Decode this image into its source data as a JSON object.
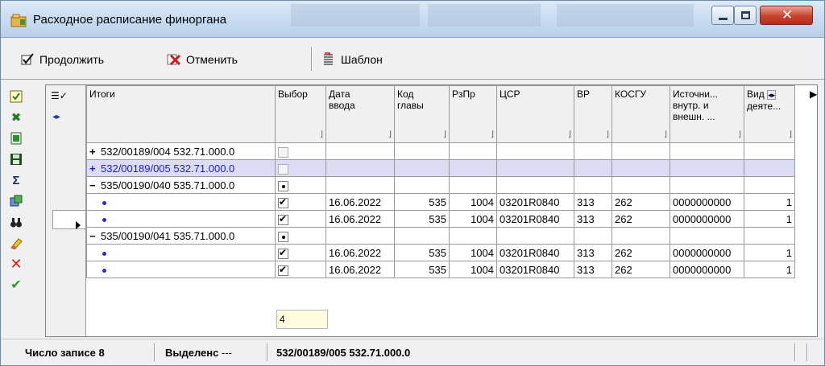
{
  "window": {
    "title": "Расходное расписание финоргана"
  },
  "toolbar": {
    "continue_label": "Продолжить",
    "cancel_label": "Отменить",
    "template_label": "Шаблон"
  },
  "grid": {
    "columns": {
      "itogi": "Итоги",
      "vybor": "Выбор",
      "data_vvoda_1": "Дата",
      "data_vvoda_2": "ввода",
      "kod_glavy_1": "Код",
      "kod_glavy_2": "главы",
      "rzpr": "РзПр",
      "csr": "ЦСР",
      "vr": "ВР",
      "kosgu": "КОСГУ",
      "istochnik_1": "Источни...",
      "istochnik_2": "внутр. и",
      "istochnik_3": "внешн. ...",
      "vid_1": "Вид",
      "vid_2": "деяте..."
    },
    "groups": [
      {
        "sign": "+",
        "label": "532/00189/004 532.71.000.0"
      },
      {
        "sign": "+",
        "label": "532/00189/005 532.71.000.0"
      },
      {
        "sign": "−",
        "label": "535/00190/040 535.71.000.0"
      },
      {
        "sign": "−",
        "label": "535/00190/041 535.71.000.0"
      }
    ],
    "rows": [
      {
        "date": "16.06.2022",
        "kod": "535",
        "rzpr": "1004",
        "csr": "03201R0840",
        "vr": "313",
        "kosgu": "262",
        "ist": "0000000000",
        "vid": "1"
      },
      {
        "date": "16.06.2022",
        "kod": "535",
        "rzpr": "1004",
        "csr": "03201R0840",
        "vr": "313",
        "kosgu": "262",
        "ist": "0000000000",
        "vid": "1"
      },
      {
        "date": "16.06.2022",
        "kod": "535",
        "rzpr": "1004",
        "csr": "03201R0840",
        "vr": "313",
        "kosgu": "262",
        "ist": "0000000000",
        "vid": "1"
      },
      {
        "date": "16.06.2022",
        "kod": "535",
        "rzpr": "1004",
        "csr": "03201R0840",
        "vr": "313",
        "kosgu": "262",
        "ist": "0000000000",
        "vid": "1"
      }
    ],
    "footer_value": "4"
  },
  "status": {
    "count_label": "Число записе",
    "count_value": "8",
    "selected_label": "Выделенс",
    "selected_value": "---",
    "current_record": "532/00189/005 532.71.000.0"
  },
  "colors": {
    "selected_row_bg": "#dcdcf6",
    "selected_row_text": "#1c1cd8",
    "footer_input_bg": "#fffde0"
  }
}
